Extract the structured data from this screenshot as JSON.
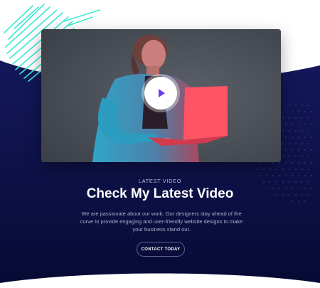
{
  "video": {
    "play_icon": "play-icon"
  },
  "section": {
    "eyebrow": "LATEST VIDEO",
    "title": "Check My Latest Video",
    "description_lines": [
      "We are passionate about our work. Our designers stay ahead of the",
      "curve to provide engaging and user-friendly website designs to make",
      "your business stand out."
    ]
  },
  "cta": {
    "label": "CONTACT TODAY"
  },
  "colors": {
    "background_navy": "#0b0e45",
    "scribble_teal": "#3ee8d4",
    "accent_purple": "#6a3ee8",
    "laptop_red": "#ff4a5e",
    "text_white": "#ffffff",
    "text_muted": "#a9b0c8"
  }
}
